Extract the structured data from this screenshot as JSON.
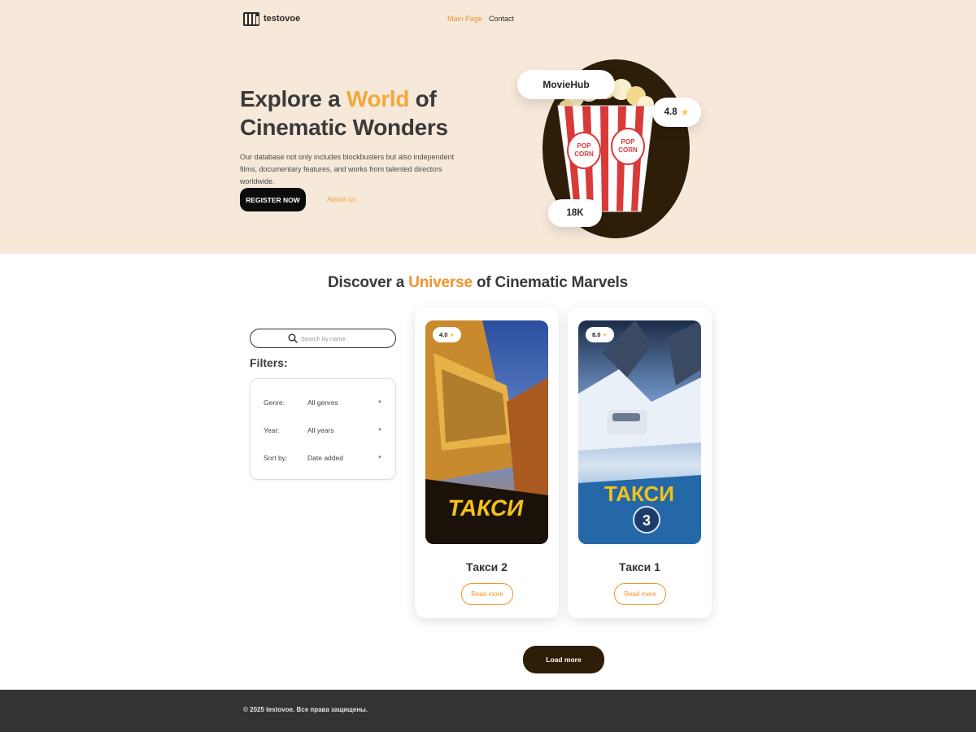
{
  "header": {
    "logo_text": "testovoe",
    "nav": [
      {
        "label": "Main Page",
        "active": true
      },
      {
        "label": "Contact",
        "active": false
      }
    ]
  },
  "hero": {
    "title_part1": "Explore a ",
    "title_accent": "World",
    "title_part2": " of",
    "title_line2": "Cinematic Wonders",
    "description": "Our database not only includes blockbusters but also independent films, documentary features, and works from talented directors worldwide.",
    "register_label": "REGISTER NOW",
    "about_label": "About us",
    "badge_brand": "MovieHub",
    "badge_rating": "4.8",
    "badge_count": "18K"
  },
  "discover": {
    "title_part1": "Discover a ",
    "title_accent": "Universe",
    "title_part2": " of Cinematic Marvels"
  },
  "search": {
    "placeholder": "Search by name",
    "icon": "search-icon"
  },
  "filters": {
    "title": "Filters:",
    "rows": [
      {
        "label": "Genre:",
        "value": "All genres"
      },
      {
        "label": "Year:",
        "value": "All years"
      },
      {
        "label": "Sort by:",
        "value": "Date added"
      }
    ]
  },
  "movies": [
    {
      "title": "Такси 2",
      "rating": "4.0",
      "read_more": "Read more",
      "poster_text": "ТАКСИ"
    },
    {
      "title": "Такси 1",
      "rating": "8.0",
      "read_more": "Read more",
      "poster_text": "ТАКСИ"
    }
  ],
  "load_more_label": "Load more",
  "footer": {
    "text": "© 2025 testovoe. Все права защищены."
  },
  "colors": {
    "accent": "#f0932b",
    "hero_bg": "#f6e9da",
    "dark_brown": "#2e1d08",
    "footer_bg": "#333333"
  }
}
